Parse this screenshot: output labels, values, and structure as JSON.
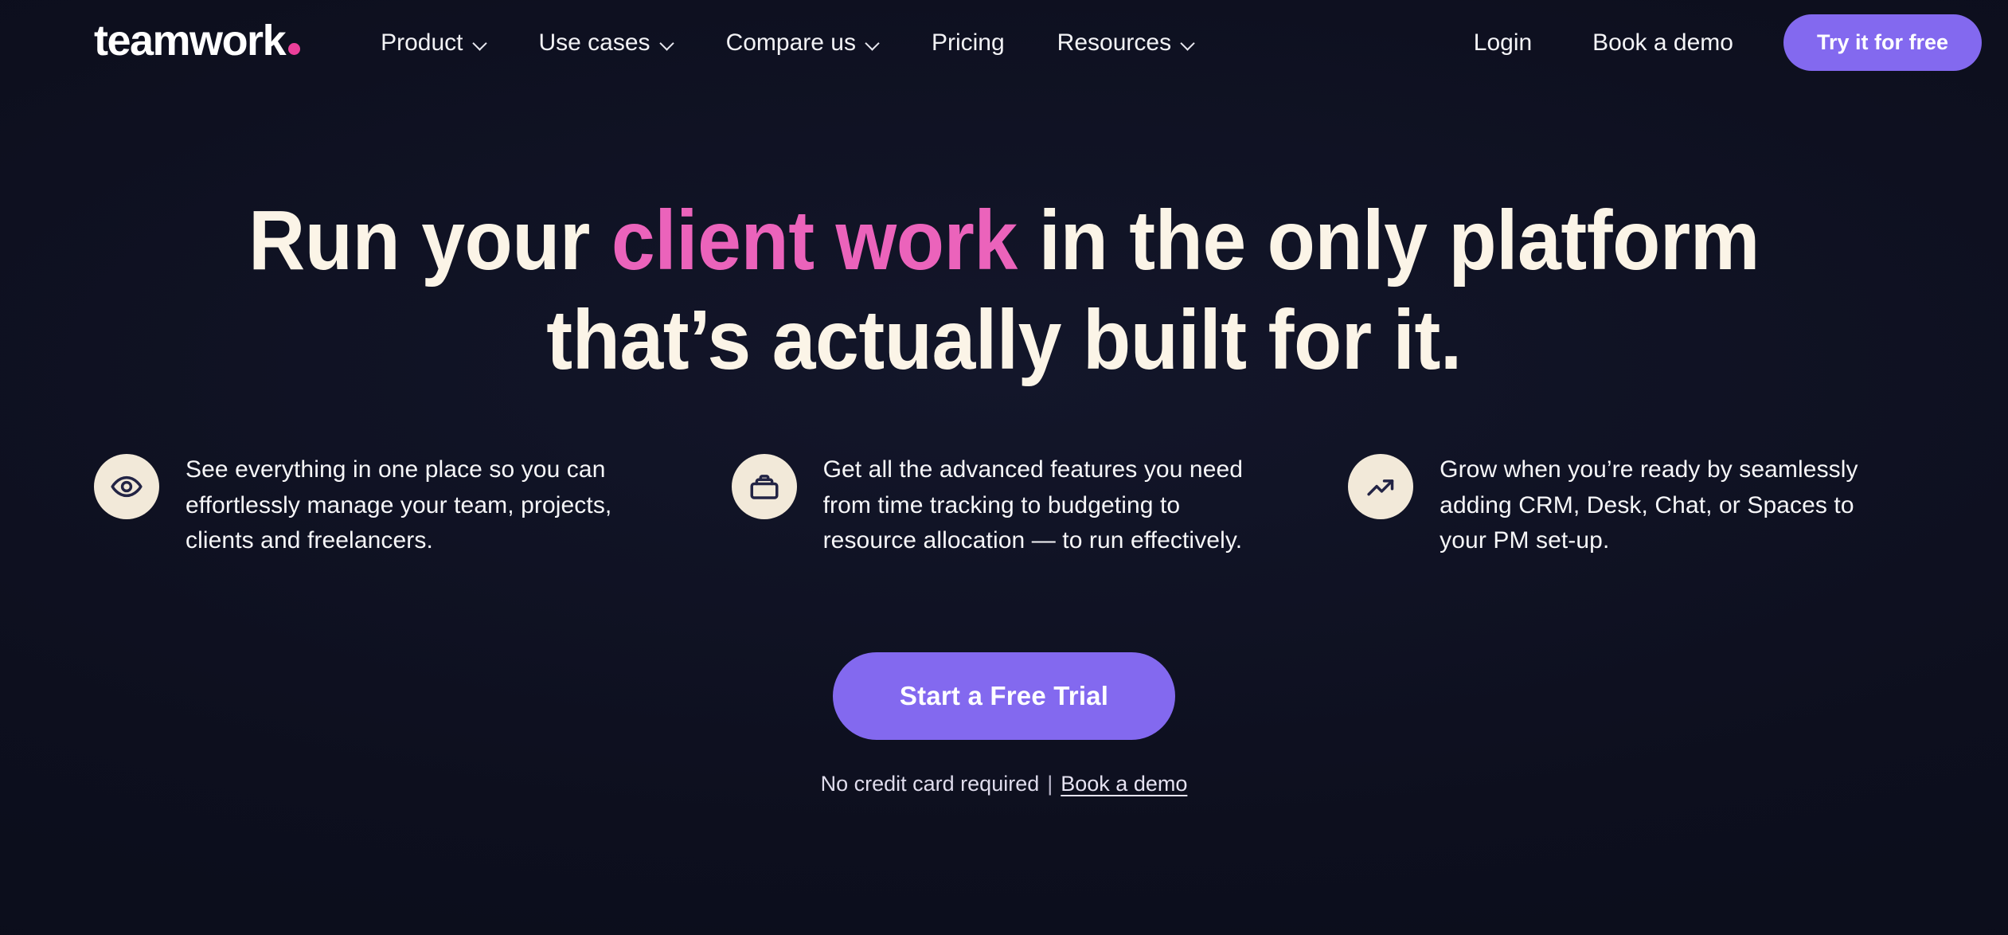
{
  "brand": {
    "name": "teamwork",
    "dot_color": "#ec3f9a"
  },
  "nav": {
    "links": [
      {
        "label": "Product",
        "has_chevron": true
      },
      {
        "label": "Use cases",
        "has_chevron": true
      },
      {
        "label": "Compare us",
        "has_chevron": true
      },
      {
        "label": "Pricing",
        "has_chevron": false
      },
      {
        "label": "Resources",
        "has_chevron": true
      }
    ],
    "login_label": "Login",
    "book_demo_label": "Book a demo",
    "try_free_label": "Try it for free",
    "try_free_color": "#8369ef"
  },
  "hero": {
    "title_part1": "Run your ",
    "title_highlight": "client work",
    "title_part2": " in the only platform that’s actually built for it.",
    "highlight_color": "#eb63bb",
    "title_color": "#fbf4e7"
  },
  "features": [
    {
      "icon": "eye-icon",
      "text": "See everything in one place so you can effortlessly manage your team, projects, clients and freelancers."
    },
    {
      "icon": "briefcase-icon",
      "text": "Get all the advanced features you need from time tracking to budgeting to resource allocation — to run effectively."
    },
    {
      "icon": "trending-up-icon",
      "text": "Grow when you’re ready by seamlessly adding CRM, Desk, Chat, or Spaces to your PM set-up."
    }
  ],
  "cta": {
    "button_label": "Start a Free Trial",
    "button_color": "#8369ef",
    "note_text": "No credit card required",
    "note_separator": "|",
    "note_link": "Book a demo"
  }
}
